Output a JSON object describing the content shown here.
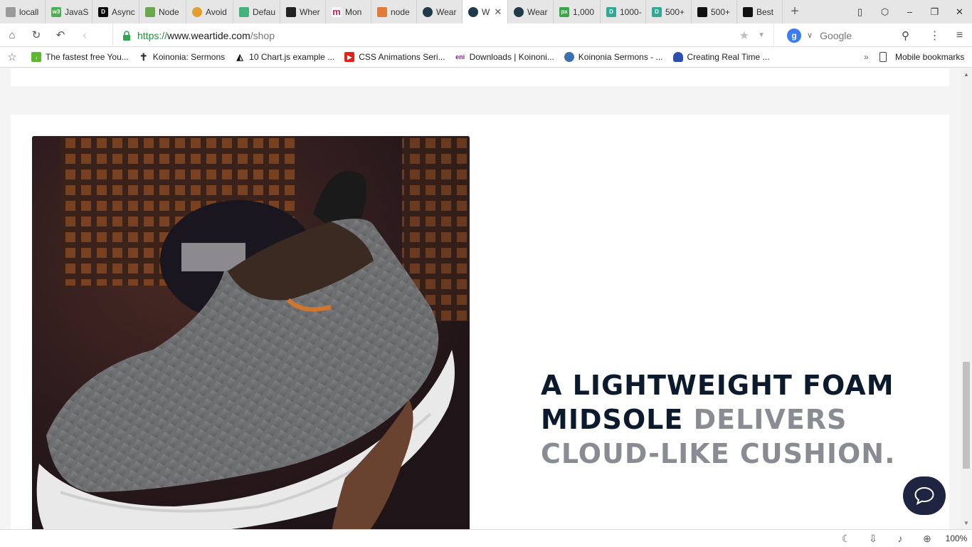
{
  "tabs": [
    {
      "label": "locall",
      "icon": "page-icon",
      "color": "#9a9a9a"
    },
    {
      "label": "JavaS",
      "icon": "w3schools-icon",
      "color": "#4caf50"
    },
    {
      "label": "Async",
      "icon": "dev-icon",
      "color": "#0a0a0a"
    },
    {
      "label": "Node",
      "icon": "node-icon",
      "color": "#6aa84f"
    },
    {
      "label": "Avoid",
      "icon": "sun-icon",
      "color": "#e0a030"
    },
    {
      "label": "Defau",
      "icon": "shield-icon",
      "color": "#44b07a"
    },
    {
      "label": "Wher",
      "icon": "stackoverflow-icon",
      "color": "#222222"
    },
    {
      "label": "Mon",
      "icon": "medium-icon",
      "color": "#c02060"
    },
    {
      "label": "node",
      "icon": "fire-icon",
      "color": "#e07b39"
    },
    {
      "label": "Wear",
      "icon": "react-icon",
      "color": "#1f3a4a"
    },
    {
      "label": "W",
      "icon": "react-icon",
      "color": "#1f3a4a",
      "active": true
    },
    {
      "label": "Wear",
      "icon": "react-icon",
      "color": "#1f3a4a"
    },
    {
      "label": "1,000",
      "icon": "px-icon",
      "color": "#3aa64a"
    },
    {
      "label": "1000-",
      "icon": "d-icon",
      "color": "#2fa895"
    },
    {
      "label": "500+",
      "icon": "d-icon",
      "color": "#2fa895"
    },
    {
      "label": "500+",
      "icon": "unsplash-icon",
      "color": "#111111"
    },
    {
      "label": "Best",
      "icon": "unsplash-icon",
      "color": "#111111"
    }
  ],
  "address": {
    "scheme": "https://",
    "host": "www.weartide.com",
    "path": "/shop",
    "search_engine": "Google"
  },
  "bookmarks": [
    {
      "label": "The fastest free You...",
      "icon": "download-icon",
      "color": "#5fb832"
    },
    {
      "label": "Koinonia: Sermons",
      "icon": "cross-icon",
      "color": "#333333"
    },
    {
      "label": "10 Chart.js example ...",
      "icon": "codepen-icon",
      "color": "#111111"
    },
    {
      "label": "CSS Animations Seri...",
      "icon": "youtube-icon",
      "color": "#e62117"
    },
    {
      "label": "Downloads | Koinoni...",
      "icon": "eni-icon",
      "color": "#7a2a7a"
    },
    {
      "label": "Koinonia Sermons - ...",
      "icon": "globe-icon",
      "color": "#3b6fb6"
    },
    {
      "label": "Creating Real Time ...",
      "icon": "cloud-icon",
      "color": "#2d4fb0"
    }
  ],
  "bookmarks_more": "»",
  "mobile_bookmarks": "Mobile bookmarks",
  "headline": {
    "line1": "A LIGHTWEIGHT FOAM",
    "line2_dark": "MIDSOLE ",
    "line2_grey": "DELIVERS",
    "line3_grey": "CLOUD-LIKE CUSHION."
  },
  "zoom": "100%",
  "colors": {
    "headline_dark": "#0c1a2e",
    "headline_grey": "#8a8c93",
    "chat_button": "#1f2541",
    "secure_green": "#31a84f"
  }
}
